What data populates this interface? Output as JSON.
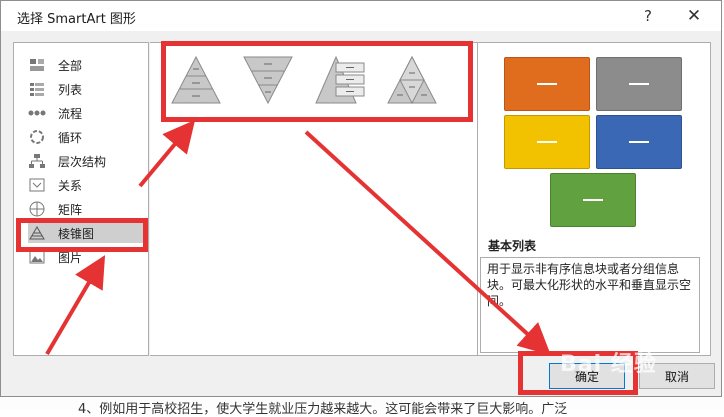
{
  "dialog": {
    "title": "选择 SmartArt 图形",
    "help_symbol": "?",
    "close_symbol": "✕"
  },
  "categories": [
    {
      "label": "全部",
      "icon": "all-icon"
    },
    {
      "label": "列表",
      "icon": "list-icon"
    },
    {
      "label": "流程",
      "icon": "process-icon"
    },
    {
      "label": "循环",
      "icon": "cycle-icon"
    },
    {
      "label": "层次结构",
      "icon": "hierarchy-icon"
    },
    {
      "label": "关系",
      "icon": "relationship-icon"
    },
    {
      "label": "矩阵",
      "icon": "matrix-icon"
    },
    {
      "label": "棱锥图",
      "icon": "pyramid-icon",
      "selected": true
    },
    {
      "label": "图片",
      "icon": "picture-icon"
    }
  ],
  "layouts": [
    "basic-pyramid",
    "inverted-pyramid",
    "pyramid-list",
    "segmented-pyramid"
  ],
  "preview": {
    "title": "基本列表",
    "description": "用于显示非有序信息块或者分组信息块。可最大化形状的水平和垂直显示空间。",
    "colors": [
      "#e06d1e",
      "#8c8c8c",
      "#f2c200",
      "#3a68b5",
      "#62a140"
    ]
  },
  "buttons": {
    "ok": "确定",
    "cancel": "取消"
  },
  "watermark": "Bai 经验",
  "background_text": "4、例如用于高校招生，使大学生就业压力越来越大。这可能会带来了巨大影响。广泛",
  "colors": {
    "annotation": "#e53333",
    "accent": "#0078d7"
  }
}
